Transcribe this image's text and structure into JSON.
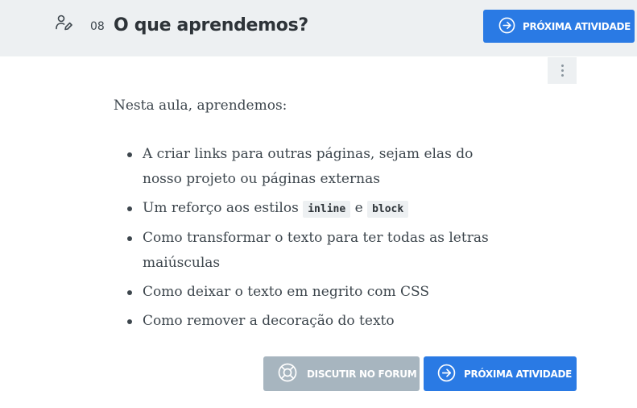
{
  "header": {
    "lesson_number": "08",
    "title": "O que aprendemos?",
    "next_button_label": "PRÓXIMA ATIVIDADE"
  },
  "content": {
    "intro": "Nesta aula, aprendemos:",
    "items": [
      {
        "text": "A criar links para outras páginas, sejam elas do nosso projeto ou páginas externas"
      },
      {
        "text_before": "Um reforço aos estilos",
        "code1": "inline",
        "connector": "e",
        "code2": "block"
      },
      {
        "text": "Como transformar o texto para ter todas as letras maiúsculas"
      },
      {
        "text": "Como deixar o texto em negrito com CSS"
      },
      {
        "text": "Como remover a decoração do texto"
      }
    ]
  },
  "footer": {
    "forum_button_label": "DISCUTIR NO FORUM",
    "next_button_label": "PRÓXIMA ATIVIDADE"
  },
  "icons": {
    "task": "user-edit-icon",
    "next": "arrow-right-circle-icon",
    "forum": "lifebuoy-icon",
    "menu": "kebab-menu-icon"
  },
  "colors": {
    "primary": "#2a7ae4",
    "secondary_button": "#a7b5bf",
    "topbar_bg": "#edf0f2",
    "text": "#3d464d"
  }
}
